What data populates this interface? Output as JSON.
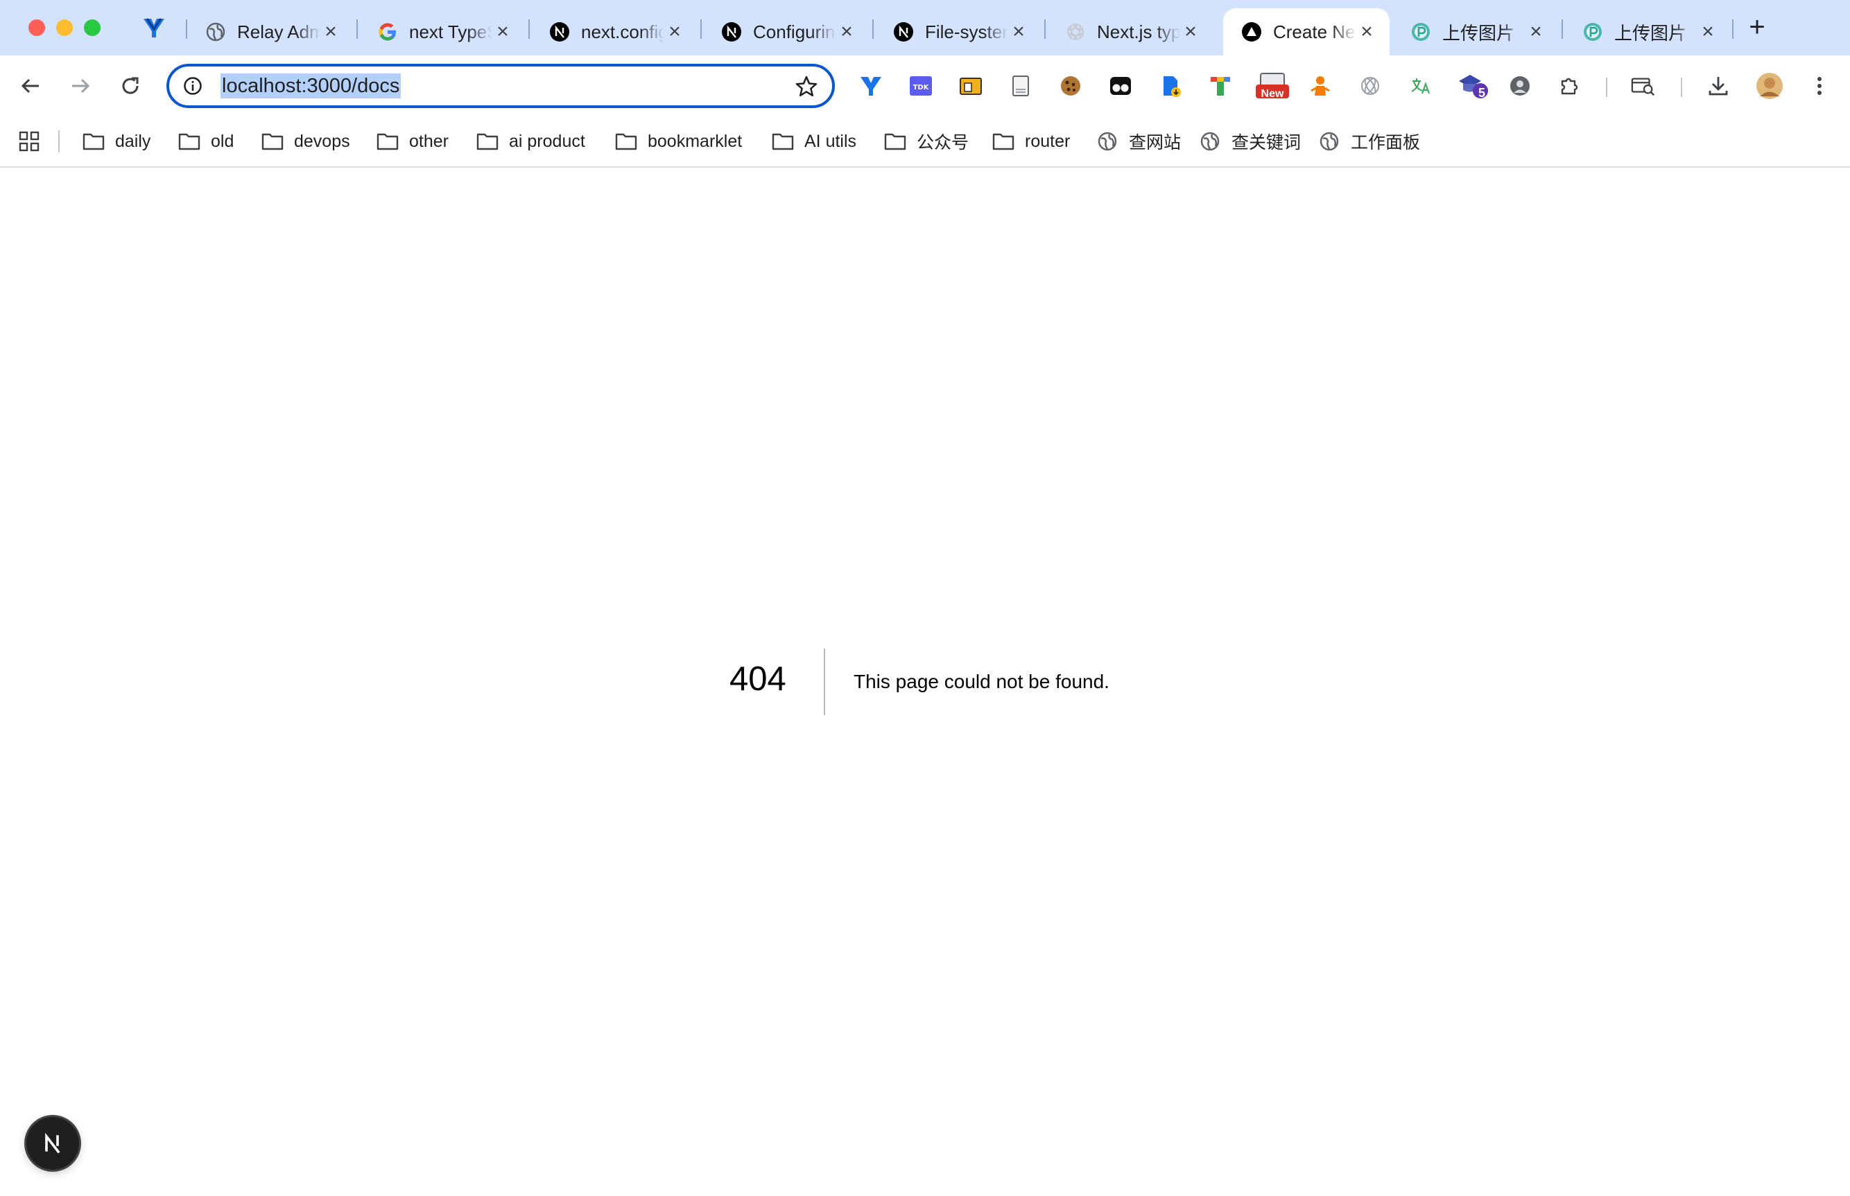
{
  "tabs": [
    {
      "title": "Relay Admin",
      "favicon": "globe-icon"
    },
    {
      "title": "next TypeScript",
      "favicon": "google-icon"
    },
    {
      "title": "next.config",
      "favicon": "nextjs-icon"
    },
    {
      "title": "Configuring",
      "favicon": "nextjs-icon"
    },
    {
      "title": "File-system",
      "favicon": "nextjs-icon"
    },
    {
      "title": "Next.js types",
      "favicon": "openai-icon"
    },
    {
      "title": "Create Next",
      "favicon": "vercel-icon",
      "active": true
    },
    {
      "title": "上传图片",
      "favicon": "upload-p-icon"
    },
    {
      "title": "上传图片",
      "favicon": "upload-p-icon"
    }
  ],
  "omnibox": {
    "url": "localhost:3000/docs"
  },
  "extensions": {
    "new_badge": "New",
    "count_badge": "5"
  },
  "bookmarks": [
    {
      "label": "daily",
      "icon": "folder-icon"
    },
    {
      "label": "old",
      "icon": "folder-icon"
    },
    {
      "label": "devops",
      "icon": "folder-icon"
    },
    {
      "label": "other",
      "icon": "folder-icon"
    },
    {
      "label": "ai product",
      "icon": "folder-icon"
    },
    {
      "label": "bookmarklet",
      "icon": "folder-icon"
    },
    {
      "label": "AI utils",
      "icon": "folder-icon"
    },
    {
      "label": "公众号",
      "icon": "folder-icon"
    },
    {
      "label": "router",
      "icon": "folder-icon"
    },
    {
      "label": "查网站",
      "icon": "globe-icon"
    },
    {
      "label": "查关键词",
      "icon": "globe-icon"
    },
    {
      "label": "工作面板",
      "icon": "globe-icon"
    }
  ],
  "error": {
    "code": "404",
    "message": "This page could not be found."
  },
  "colors": {
    "tabstrip": "#d3e3fd",
    "accent": "#0b57d0",
    "selection": "#b3d0fb"
  }
}
